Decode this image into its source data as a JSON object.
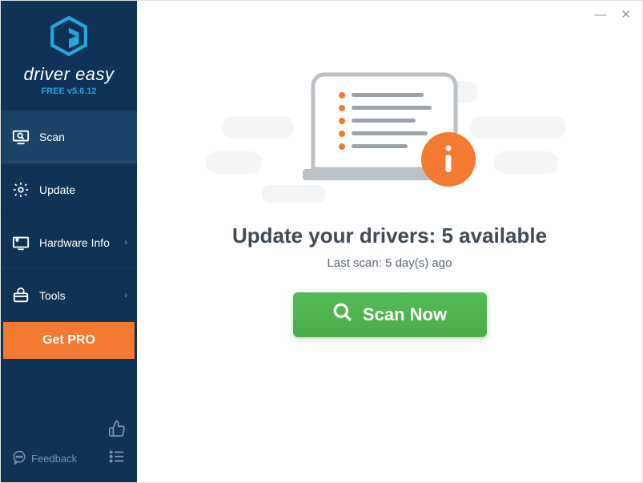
{
  "brand": {
    "name": "driver easy",
    "version": "FREE v5.6.12"
  },
  "nav": {
    "scan": {
      "label": "Scan"
    },
    "update": {
      "label": "Update"
    },
    "hardware_info": {
      "label": "Hardware Info"
    },
    "tools": {
      "label": "Tools"
    },
    "get_pro": {
      "label": "Get PRO"
    }
  },
  "footer": {
    "feedback": "Feedback"
  },
  "window": {
    "minimize": "—",
    "close": "✕"
  },
  "main": {
    "headline_pre": "Update your drivers: ",
    "headline_count": "5",
    "headline_post": " available",
    "subline": "Last scan: 5 day(s) ago",
    "scan_button": "Scan Now"
  },
  "colors": {
    "accent": "#f47a32",
    "scan_green": "#49ad4a",
    "info_orange": "#f47a32"
  }
}
